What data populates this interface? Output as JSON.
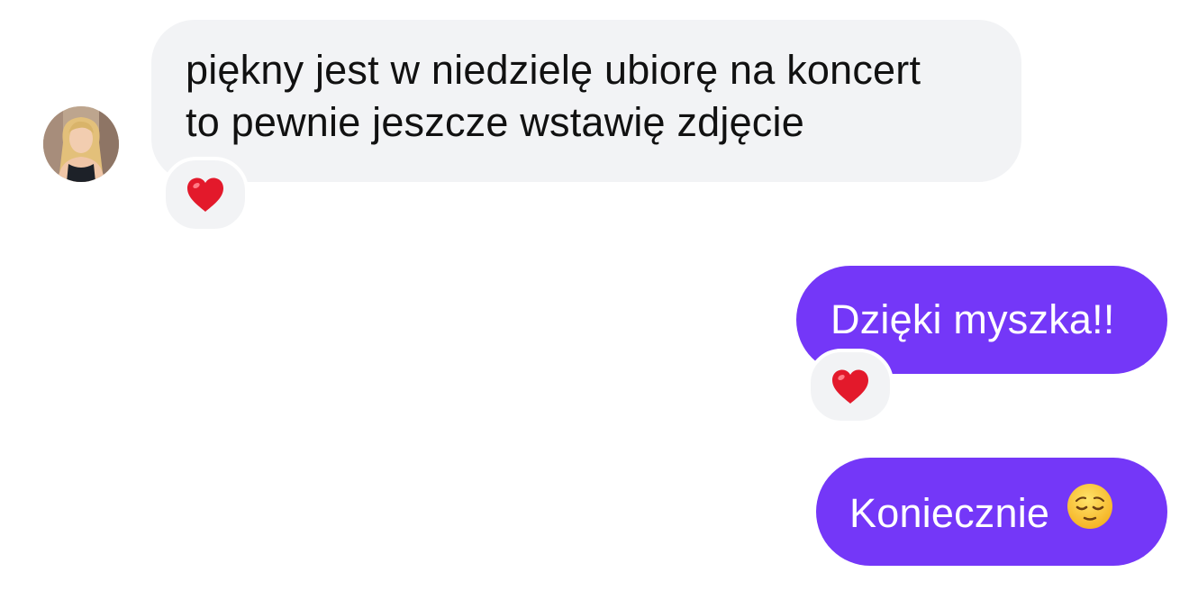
{
  "messages": [
    {
      "direction": "incoming",
      "lines": [
        "piękny jest w niedzielę ubiorę na koncert",
        "to pewnie jeszcze wstawię zdjęcie"
      ],
      "reaction": "red-heart-emoji"
    },
    {
      "direction": "outgoing",
      "text": "Dzięki myszka!!",
      "reaction": "red-heart-emoji"
    },
    {
      "direction": "outgoing",
      "text": "Koniecznie",
      "trailing_emoji": "relieved-face-emoji"
    }
  ],
  "colors": {
    "outgoing_bubble": "#7437f8",
    "incoming_bubble": "#f2f3f5",
    "heart": "#e3192b"
  }
}
